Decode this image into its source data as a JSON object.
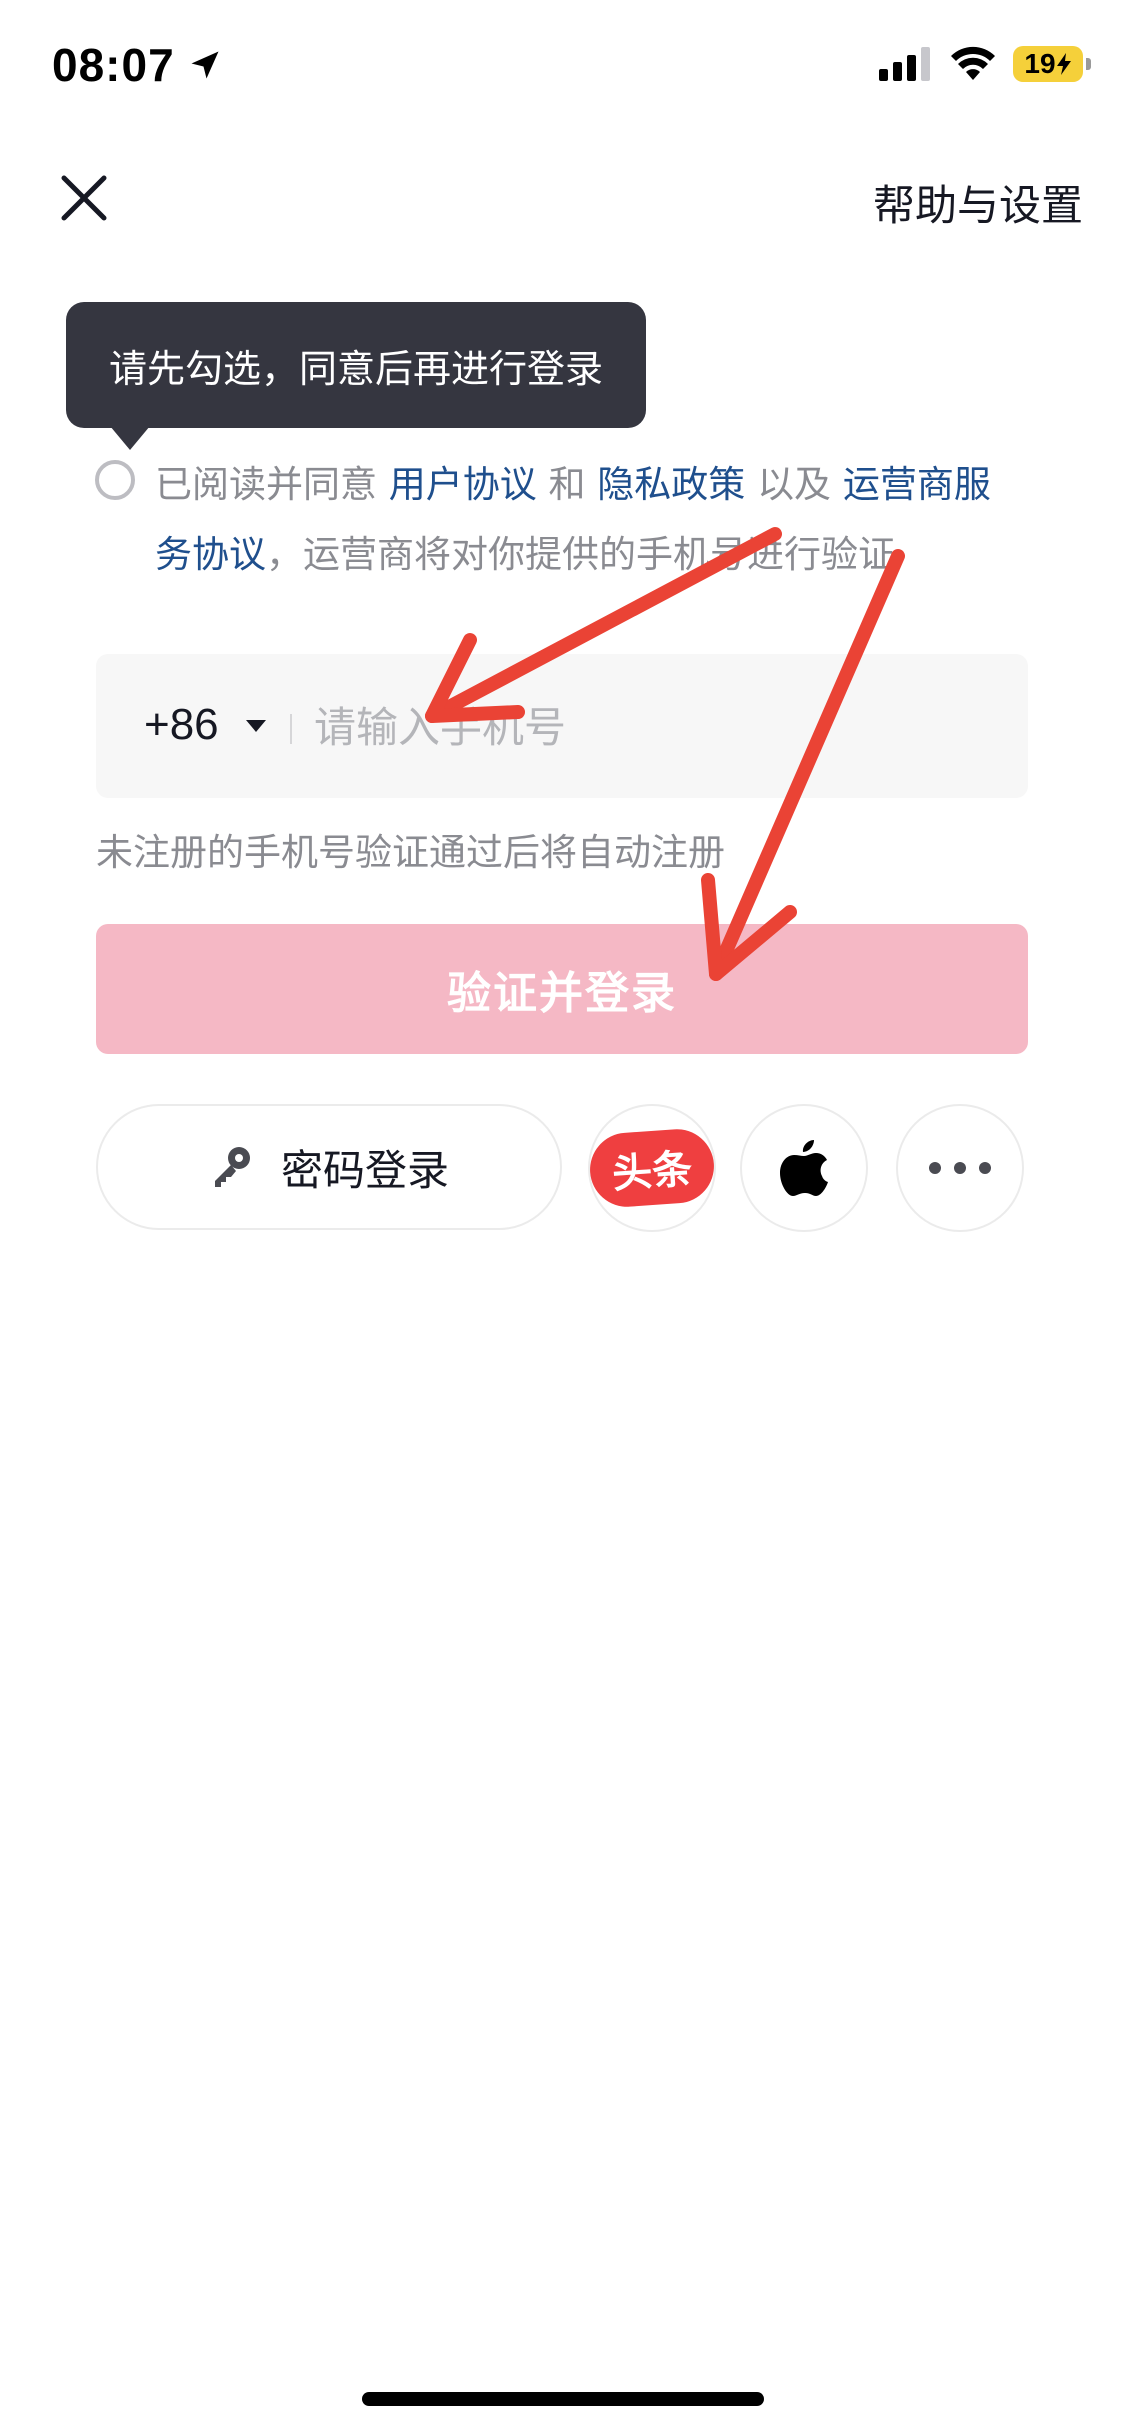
{
  "status_bar": {
    "time": "08:07",
    "battery": "19"
  },
  "header": {
    "close_icon": "close-icon",
    "help_label": "帮助与设置"
  },
  "tooltip": {
    "text": "请先勾选，同意后再进行登录"
  },
  "agreement": {
    "prefix": "已阅读并同意",
    "user_agreement": "用户协议",
    "and": "和",
    "privacy_policy": "隐私政策",
    "as_well_as": "以及",
    "carrier_service_agreement": "运营商服务协议",
    "suffix": "，运营商将对你提供的手机号进行验证",
    "checked": false
  },
  "phone_input": {
    "country_code": "+86",
    "placeholder": "请输入手机号",
    "value": ""
  },
  "hint": "未注册的手机号验证通过后将自动注册",
  "login_button": {
    "label": "验证并登录",
    "enabled": false
  },
  "alt_login": {
    "password_login_label": "密码登录",
    "toutiao_label": "头条",
    "apple_icon": "apple-icon",
    "more_icon": "more-icon"
  },
  "colors": {
    "link": "#1f4f8d",
    "disabled_button": "#f5b8c5",
    "annotation_arrow": "#ea4335",
    "toutiao": "#ef3f40"
  }
}
